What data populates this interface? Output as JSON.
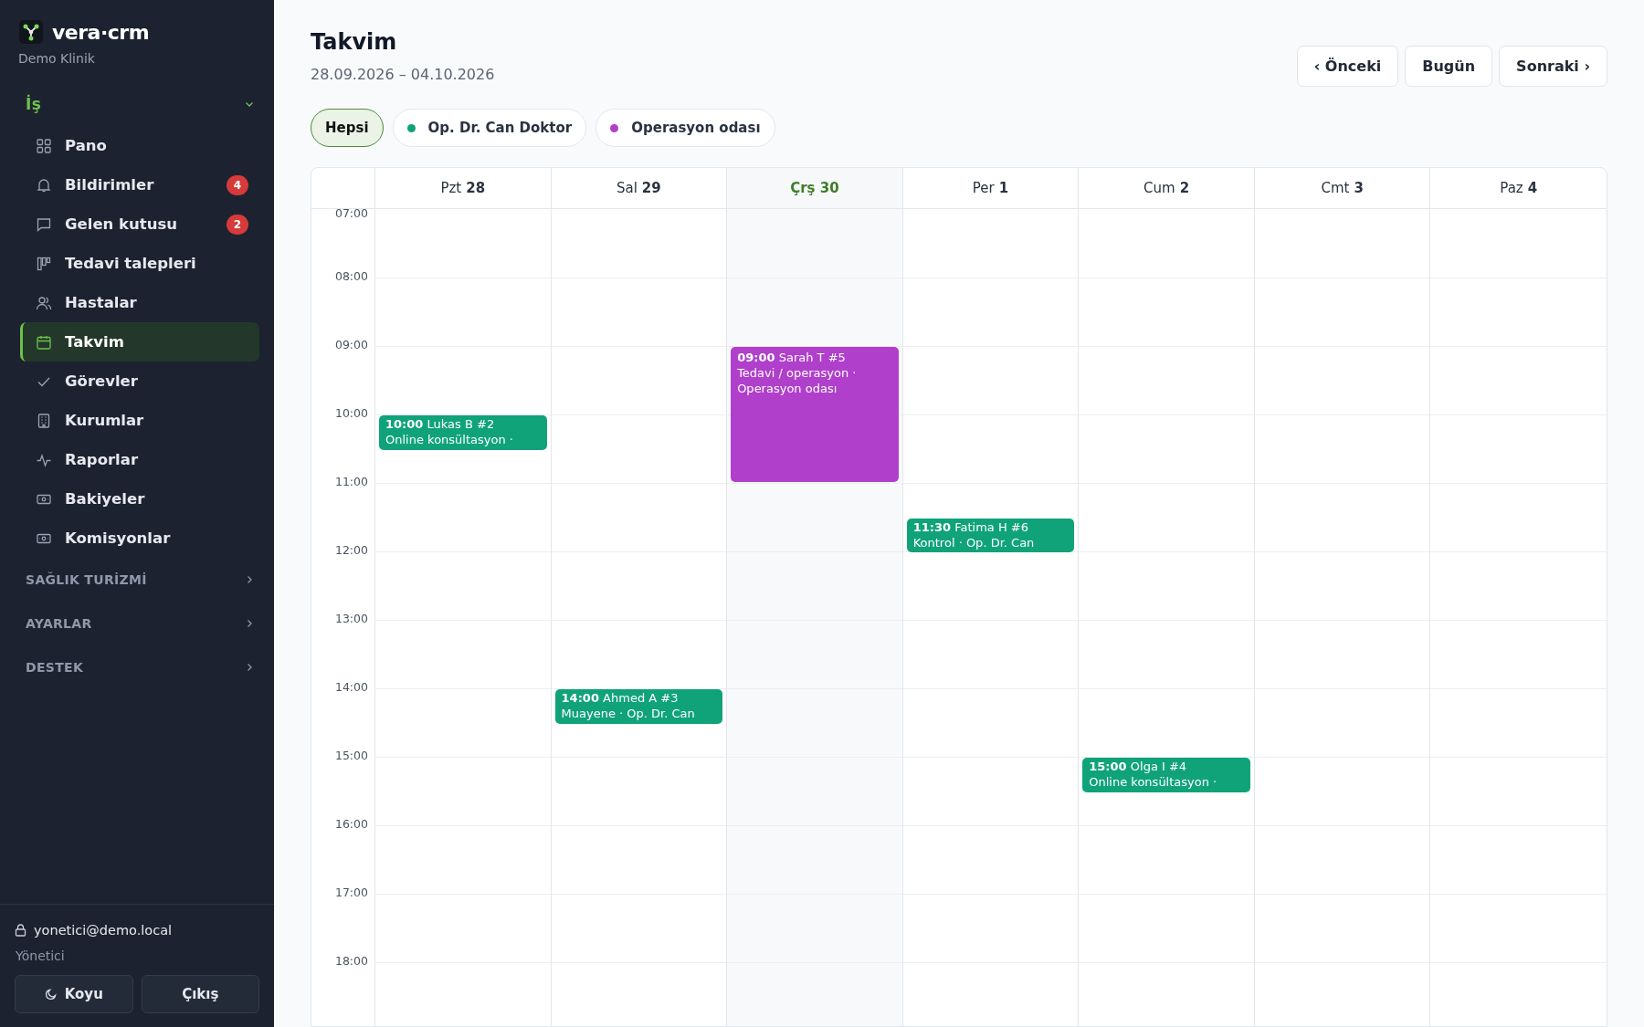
{
  "brand": {
    "name": "vera·crm",
    "org": "Demo Klinik"
  },
  "nav_groups": [
    {
      "label": "İş",
      "expanded": true,
      "items": [
        {
          "label": "Pano",
          "selected": false
        },
        {
          "label": "Bildirimler",
          "selected": false,
          "badge": "4"
        },
        {
          "label": "Gelen kutusu",
          "selected": false,
          "badge": "2"
        },
        {
          "label": "Tedavi talepleri",
          "selected": false
        },
        {
          "label": "Hastalar",
          "selected": false
        },
        {
          "label": "Takvim",
          "selected": true
        },
        {
          "label": "Görevler",
          "selected": false
        },
        {
          "label": "Kurumlar",
          "selected": false
        },
        {
          "label": "Raporlar",
          "selected": false
        },
        {
          "label": "Bakiyeler",
          "selected": false
        },
        {
          "label": "Komisyonlar",
          "selected": false
        }
      ]
    },
    {
      "label": "SAĞLIK TURİZMİ",
      "expanded": false
    },
    {
      "label": "AYARLAR",
      "expanded": false
    },
    {
      "label": "DESTEK",
      "expanded": false
    }
  ],
  "user": {
    "email": "yonetici@demo.local",
    "role": "Yönetici",
    "buttons": [
      "Koyu",
      "Çıkış"
    ]
  },
  "page": {
    "title": "Takvim",
    "range": "28.09.2026 – 04.10.2026",
    "nav_buttons": [
      "‹ Önceki",
      "Bugün",
      "Sonraki ›"
    ]
  },
  "filters": [
    {
      "label": "Hepsi",
      "selected": true
    },
    {
      "label": "Op. Dr. Can Doktor",
      "selected": false,
      "color": "#10a37a"
    },
    {
      "label": "Operasyon odası",
      "selected": false,
      "color": "#b03fcc"
    }
  ],
  "hours": [
    "07:00",
    "08:00",
    "09:00",
    "10:00",
    "11:00",
    "12:00",
    "13:00",
    "14:00",
    "15:00",
    "16:00",
    "17:00",
    "18:00"
  ],
  "days": [
    {
      "label": "Pzt **28**",
      "today": false,
      "events": [
        {
          "time": "10:00",
          "title": "Lukas B #2",
          "detail": "Online konsültasyon ·",
          "kind": "short",
          "color": "#10a37a"
        }
      ]
    },
    {
      "label": "Sal **29**",
      "today": false,
      "events": [
        {
          "time": "14:00",
          "title": "Ahmed A #3",
          "detail": "Muayene · Op. Dr. Can",
          "kind": "short",
          "color": "#10a37a"
        }
      ]
    },
    {
      "label": "Çrş 30",
      "today": true,
      "events": [
        {
          "time": "09:00",
          "title": "Sarah T #5",
          "detail": "Tedavi / operasyon · Operasyon odası",
          "kind": "long",
          "color": "#b03fcc"
        }
      ]
    },
    {
      "label": "Per **1**",
      "today": false,
      "events": [
        {
          "time": "11:30",
          "title": "Fatima H #6",
          "detail": "Kontrol · Op. Dr. Can",
          "kind": "short",
          "color": "#10a37a"
        }
      ]
    },
    {
      "label": "Cum **2**",
      "today": false,
      "events": [
        {
          "time": "15:00",
          "title": "Olga I #4",
          "detail": "Online konsültasyon ·",
          "kind": "short",
          "color": "#10a37a"
        }
      ]
    },
    {
      "label": "Cmt **3**",
      "today": false
    },
    {
      "label": "Paz **4**",
      "today": false
    }
  ]
}
